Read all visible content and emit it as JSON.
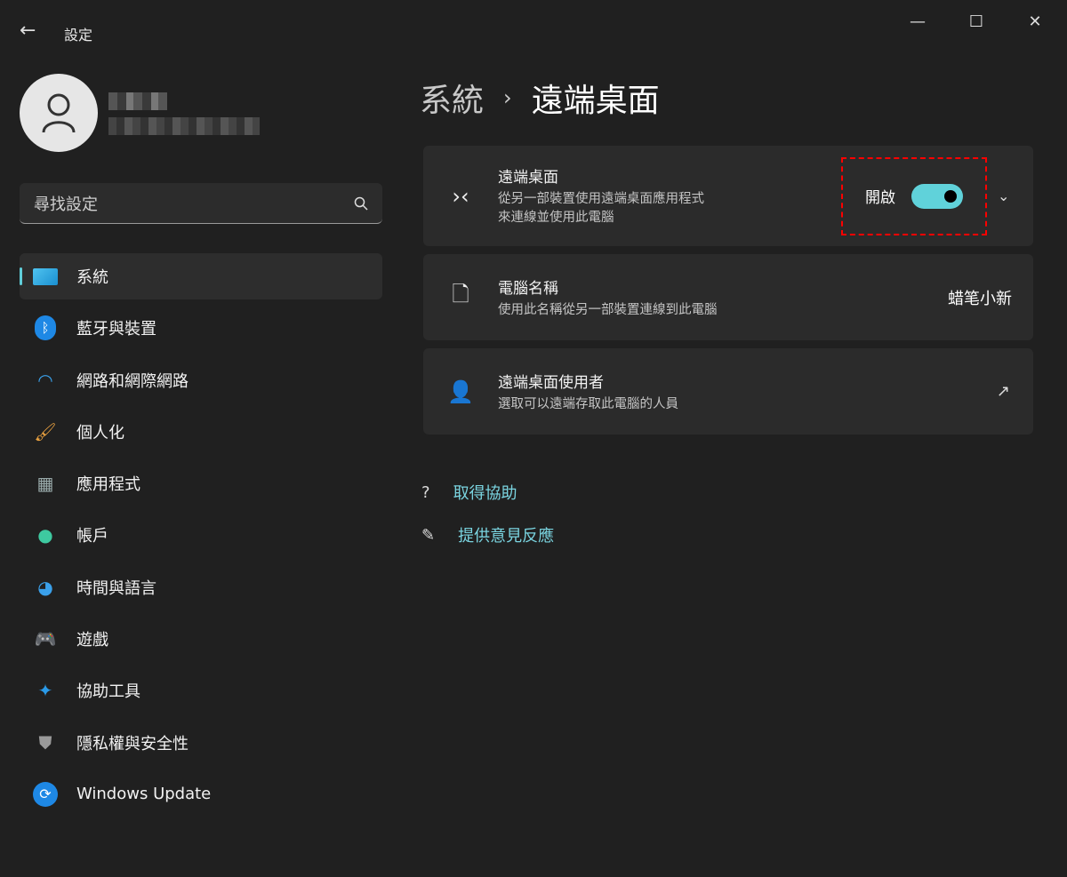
{
  "window": {
    "title": "設定",
    "back": "←",
    "minimize": "—",
    "maximize": "☐",
    "close": "✕"
  },
  "search": {
    "placeholder": "尋找設定"
  },
  "nav": [
    {
      "label": "系統",
      "icon": "monitor-icon",
      "active": true
    },
    {
      "label": "藍牙與裝置",
      "icon": "bluetooth-icon"
    },
    {
      "label": "網路和網際網路",
      "icon": "wifi-icon"
    },
    {
      "label": "個人化",
      "icon": "brush-icon"
    },
    {
      "label": "應用程式",
      "icon": "apps-icon"
    },
    {
      "label": "帳戶",
      "icon": "account-icon"
    },
    {
      "label": "時間與語言",
      "icon": "clock-globe-icon"
    },
    {
      "label": "遊戲",
      "icon": "gamepad-icon"
    },
    {
      "label": "協助工具",
      "icon": "accessibility-icon"
    },
    {
      "label": "隱私權與安全性",
      "icon": "shield-icon"
    },
    {
      "label": "Windows Update",
      "icon": "update-icon"
    }
  ],
  "breadcrumb": {
    "parent": "系統",
    "separator": "›",
    "current": "遠端桌面"
  },
  "cards": {
    "rdp": {
      "title": "遠端桌面",
      "desc1": "從另一部裝置使用遠端桌面應用程式",
      "desc2": "來連線並使用此電腦",
      "state": "開啟",
      "on": true
    },
    "pcname": {
      "title": "電腦名稱",
      "desc": "使用此名稱從另一部裝置連線到此電腦",
      "value": "蜡笔小新"
    },
    "users": {
      "title": "遠端桌面使用者",
      "desc": "選取可以遠端存取此電腦的人員"
    }
  },
  "links": {
    "help": "取得協助",
    "feedback": "提供意見反應"
  },
  "colors": {
    "accent": "#60d2da",
    "highlight": "#ff0000"
  }
}
